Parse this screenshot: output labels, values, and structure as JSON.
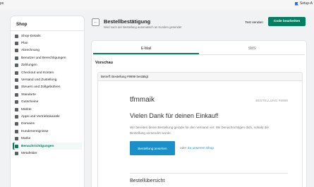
{
  "topbar": {
    "left_text": "ps",
    "right_text": "Setup-A"
  },
  "sidebar": {
    "title": "Shop",
    "items": [
      {
        "label": "Shop-Details",
        "icon": "store-icon"
      },
      {
        "label": "Plan",
        "icon": "plan-icon"
      },
      {
        "label": "Abrechnung",
        "icon": "billing-icon"
      },
      {
        "label": "Benutzer und Berechtigungen",
        "icon": "users-icon"
      },
      {
        "label": "Zahlungen",
        "icon": "payments-icon"
      },
      {
        "label": "Checkout und Konten",
        "icon": "checkout-icon"
      },
      {
        "label": "Versand und Zustellung",
        "icon": "shipping-icon"
      },
      {
        "label": "Steuern und Zollgebühren",
        "icon": "taxes-icon"
      },
      {
        "label": "Standorte",
        "icon": "location-icon"
      },
      {
        "label": "Gutscheine",
        "icon": "gift-card-icon"
      },
      {
        "label": "Märkte",
        "icon": "markets-icon"
      },
      {
        "label": "Apps und Vertriebskanäle",
        "icon": "apps-icon"
      },
      {
        "label": "Domains",
        "icon": "domains-icon"
      },
      {
        "label": "Kundenereignisse",
        "icon": "customer-events-icon"
      },
      {
        "label": "Marke",
        "icon": "brand-icon"
      },
      {
        "label": "Benachrichtigungen",
        "icon": "bell-icon",
        "active": true
      },
      {
        "label": "Metafelder",
        "icon": "metafields-icon"
      }
    ]
  },
  "header": {
    "title": "Bestellbestätigung",
    "subtitle": "Wird nach der Bestellung automatisch an Kunden gesendet",
    "test_button": "Test senden",
    "edit_button": "Code bearbeiten"
  },
  "card": {
    "tabs": [
      {
        "label": "E-Mail",
        "active": true
      },
      {
        "label": "SMS",
        "active": false
      }
    ],
    "preview_label": "Vorschau",
    "email": {
      "subject": "Betreff: Bestellung #9999 bestätigt",
      "shop_name": "tfmmaik",
      "order_number": "BESTELLUNG #9999",
      "heading": "Vielen Dank für deinen Einkauf!",
      "message": "Wir bereiten deine Bestellung gerade für den Versand vor. Wir benachrichtigen dich, sobald die Bestellung versendet wurde.",
      "view_button": "Bestellung ansehen",
      "or_text": "oder",
      "shop_link": "Zu unserem Shop",
      "summary_heading": "Bestellübersicht"
    }
  },
  "colors": {
    "accent": "#008060",
    "link": "#1990c6"
  }
}
